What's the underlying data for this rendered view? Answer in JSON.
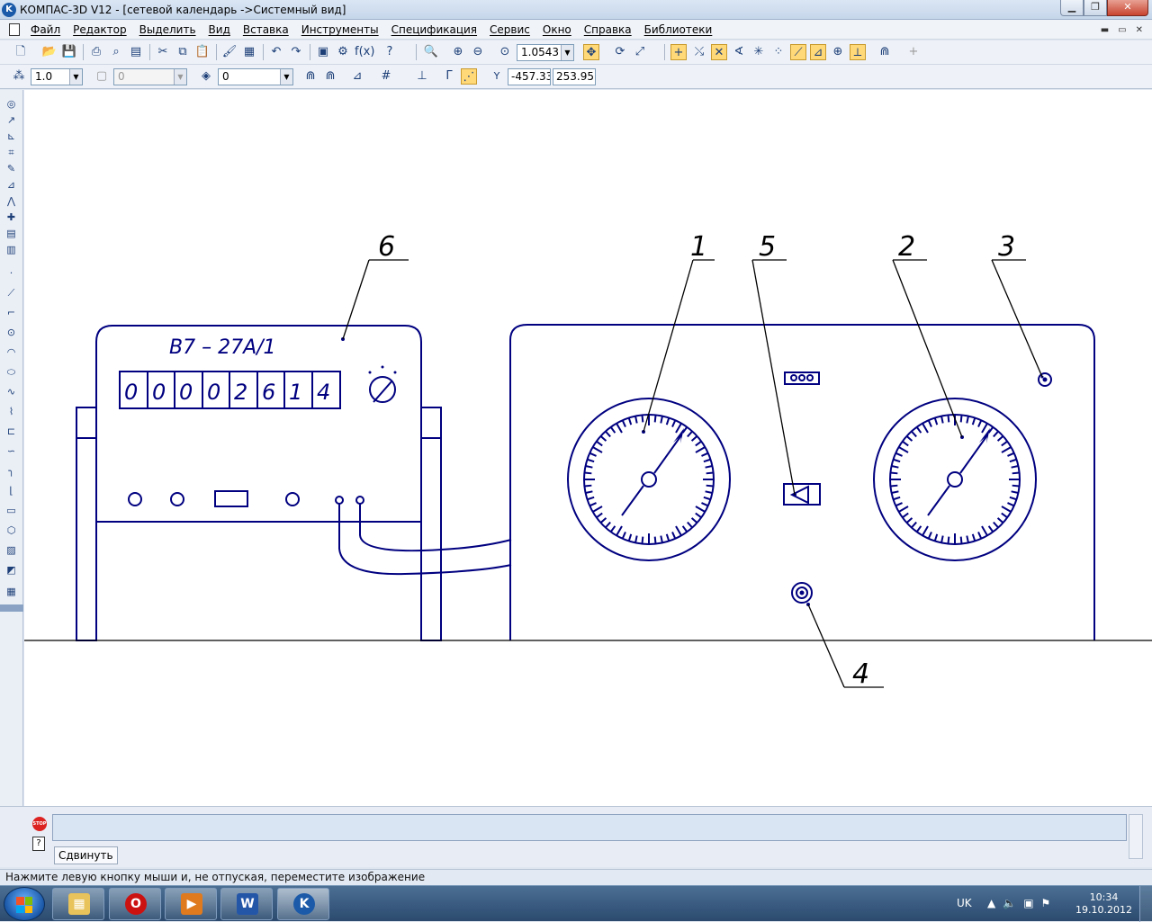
{
  "window": {
    "title": "КОМПАС-3D V12 - [сетевой календарь ->Системный вид]",
    "app_icon": "kompas-logo",
    "controls": [
      "minimize",
      "restore",
      "close"
    ]
  },
  "menu": {
    "items": [
      "Файл",
      "Редактор",
      "Выделить",
      "Вид",
      "Вставка",
      "Инструменты",
      "Спецификация",
      "Сервис",
      "Окно",
      "Справка",
      "Библиотеки"
    ]
  },
  "toolbar_main": {
    "zoom_value": "1.0543",
    "fx_label": "f(x)"
  },
  "toolbar_props": {
    "step_value": "1.0",
    "layer_value": "0",
    "style_value": "0",
    "coord_x": "-457.33",
    "coord_y": "253.95",
    "y_label": "Y"
  },
  "drawing": {
    "device_label": "В7 – 27А/1",
    "counter_digits": [
      "0",
      "0",
      "0",
      "0",
      "2",
      "6",
      "1",
      "4"
    ],
    "callouts": [
      "6",
      "1",
      "5",
      "2",
      "3",
      "4"
    ],
    "colors": {
      "line": "#000080",
      "black": "#000000"
    }
  },
  "command_panel": {
    "tab_label": "Сдвинуть",
    "stop_label": "STOP",
    "help_label": "?"
  },
  "status": {
    "text": "Нажмите левую кнопку мыши и, не отпуская, переместите изображение"
  },
  "taskbar": {
    "items": [
      "explorer-icon",
      "opera-icon",
      "media-player-icon",
      "word-icon",
      "kompas-icon"
    ],
    "language": "UK",
    "time": "10:34",
    "date": "19.10.2012"
  }
}
